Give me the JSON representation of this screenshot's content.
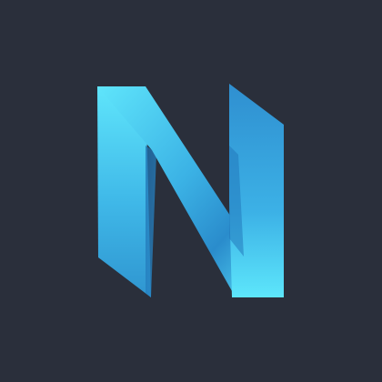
{
  "logo": {
    "letter": "N",
    "icon": "n-ribbon-logo-icon"
  },
  "colors": {
    "background": "#2a2f3b",
    "cyan_light": "#5de6fb",
    "blue_mid": "#32a9dc",
    "blue_dark": "#2278b9"
  }
}
